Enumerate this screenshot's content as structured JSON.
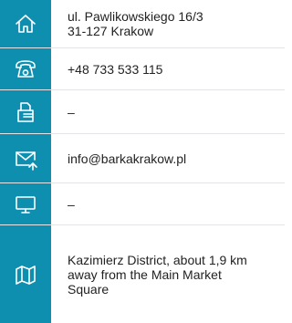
{
  "colors": {
    "icon_background": "#0f8fb0",
    "text": "#222222",
    "divider": "#e2e4e8"
  },
  "contact": {
    "address": {
      "icon": "home-icon",
      "line1": "ul. Pawlikowskiego 16/3",
      "line2": "31-127 Krakow"
    },
    "phone": {
      "icon": "phone-icon",
      "value": "+48 733 533 115"
    },
    "fax": {
      "icon": "fax-icon",
      "value": "–"
    },
    "email": {
      "icon": "mail-icon",
      "value": "info@barkakrakow.pl"
    },
    "website": {
      "icon": "monitor-icon",
      "value": "–"
    },
    "location": {
      "icon": "map-icon",
      "line1": "Kazimierz District, about 1,9 km",
      "line2": "away from the Main Market",
      "line3": "Square"
    }
  }
}
